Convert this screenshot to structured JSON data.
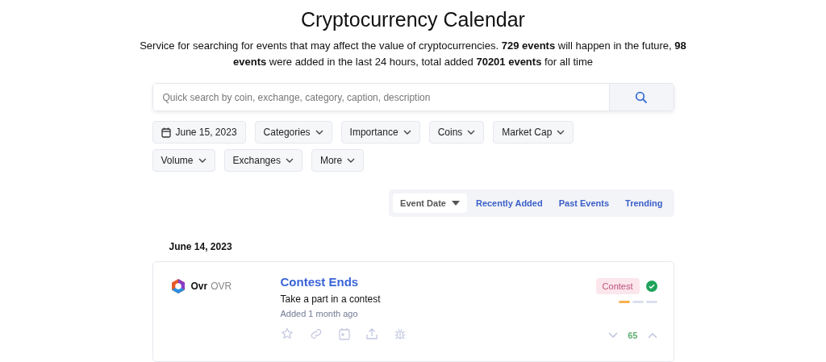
{
  "title": "Cryptocurrency Calendar",
  "intro": "Service for searching for events that may affect the value of cryptocurrencies. **729 events** will happen in the future, **98 events** were added in the last 24 hours, total added **70201 events** for all time",
  "search": {
    "placeholder": "Quick search by coin, exchange, category, caption, description"
  },
  "filters": [
    {
      "label": "June 15, 2023",
      "kind": "date"
    },
    {
      "label": "Categories",
      "kind": "dropdown"
    },
    {
      "label": "Importance",
      "kind": "dropdown"
    },
    {
      "label": "Coins",
      "kind": "dropdown"
    },
    {
      "label": "Market Cap",
      "kind": "dropdown"
    },
    {
      "label": "Volume",
      "kind": "dropdown"
    },
    {
      "label": "Exchanges",
      "kind": "dropdown"
    },
    {
      "label": "More",
      "kind": "dropdown"
    }
  ],
  "sort_tabs": [
    {
      "label": "Event Date",
      "selected": true
    },
    {
      "label": "Recently Added",
      "selected": false
    },
    {
      "label": "Past Events",
      "selected": false
    },
    {
      "label": "Trending",
      "selected": false
    }
  ],
  "date_heading": "June 14, 2023",
  "events": [
    {
      "coin_name": "Ovr",
      "coin_symbol": "OVR",
      "title": "Contest Ends",
      "description": "Take a part in a contest",
      "added": "Added 1 month ago",
      "tag": "Contest",
      "verified": true,
      "importance": [
        {
          "filled": true
        },
        {
          "filled": false
        },
        {
          "filled": false
        }
      ],
      "votes": "65"
    }
  ]
}
